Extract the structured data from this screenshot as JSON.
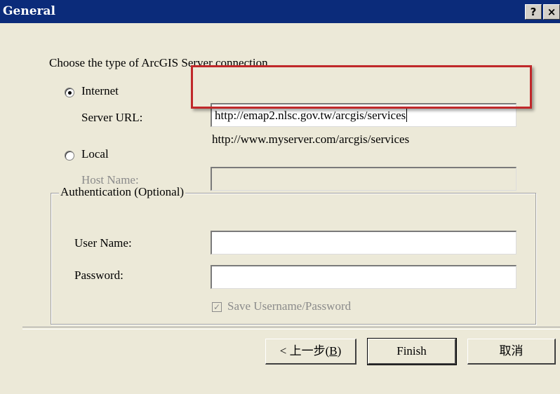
{
  "window": {
    "title": "General",
    "help_label": "?",
    "close_label": "×"
  },
  "connection": {
    "prompt": "Choose the type of ArcGIS Server connection",
    "internet_label": "Internet",
    "internet_selected": true,
    "server_url_label": "Server URL:",
    "server_url_value": "http://emap2.nlsc.gov.tw/arcgis/services",
    "server_url_hint": "http://www.myserver.com/arcgis/services",
    "local_label": "Local",
    "local_selected": false,
    "host_name_label": "Host Name:",
    "host_name_value": ""
  },
  "auth": {
    "group_title": "Authentication (Optional)",
    "user_name_label": "User Name:",
    "user_name_value": "",
    "password_label": "Password:",
    "password_value": "",
    "save_label": "Save Username/Password",
    "save_checked": true
  },
  "buttons": {
    "back_prefix": "< 上一步(",
    "back_key": "B",
    "back_suffix": ")",
    "finish_label": "Finish",
    "cancel_label": "取消"
  },
  "colors": {
    "titlebar": "#0b2b7a",
    "dialog_bg": "#ece9d8",
    "highlight_box": "#c0282a"
  }
}
